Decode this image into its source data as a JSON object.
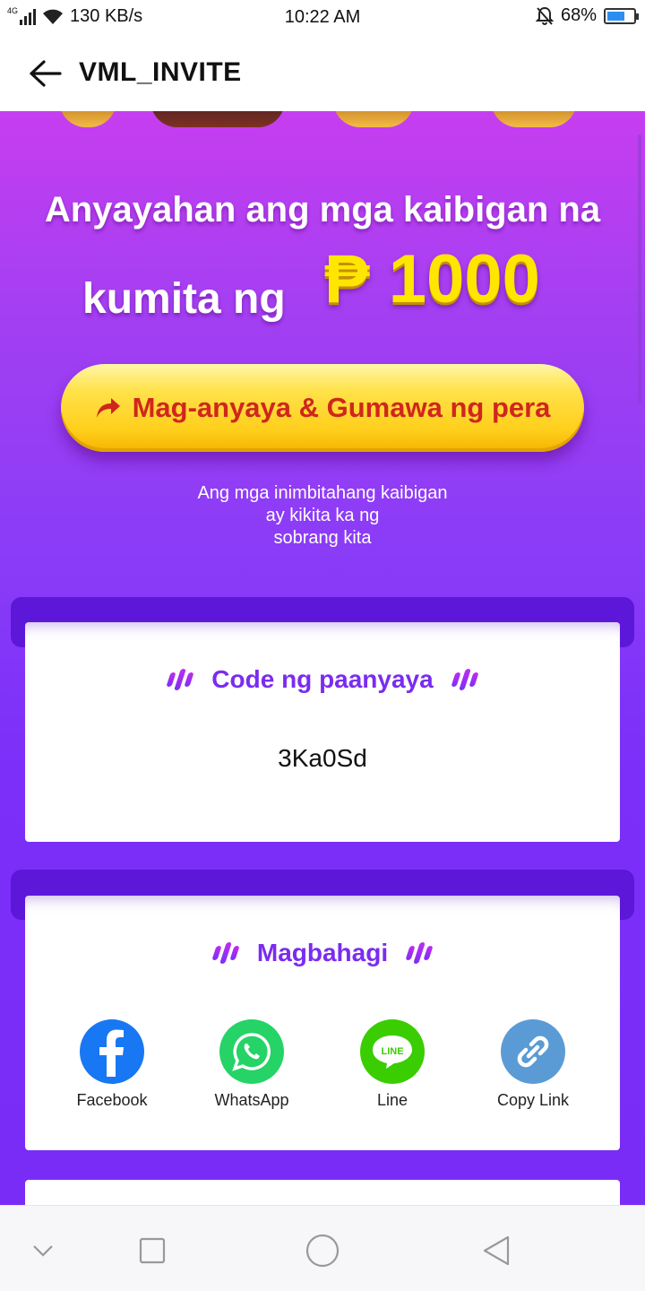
{
  "status_bar": {
    "network": "4G",
    "speed": "130 KB/s",
    "time": "10:22 AM",
    "battery": "68%",
    "battery_level": 0.68,
    "icons": [
      "signal-icon",
      "wifi-icon",
      "mute-bell-icon",
      "battery-icon"
    ]
  },
  "header": {
    "title": "VML_INVITE",
    "back_icon": "arrow-left-icon"
  },
  "hero": {
    "line1": "Anyayahan ang mga kaibigan na",
    "line2": "kumita ng",
    "amount": "₱ 1000"
  },
  "cta": {
    "label": "Mag-anyaya & Gumawa ng pera",
    "icon": "share-arrow-icon"
  },
  "subtext": {
    "line1": "Ang mga inimbitahang kaibigan",
    "line2": "ay kikita ka ng",
    "line3": "sobrang kita"
  },
  "invite_card": {
    "title": "Code ng paanyaya",
    "code": "3Ka0Sd"
  },
  "share_card": {
    "title": "Magbahagi",
    "items": [
      {
        "label": "Facebook",
        "icon": "facebook-icon",
        "color": "#1877f2"
      },
      {
        "label": "WhatsApp",
        "icon": "whatsapp-icon",
        "color": "#25d366"
      },
      {
        "label": "Line",
        "icon": "line-icon",
        "color": "#3acd01"
      },
      {
        "label": "Copy Link",
        "icon": "link-icon",
        "color": "#5b9bd5"
      }
    ]
  },
  "colors": {
    "accent_purple": "#7a2cf0",
    "cta_text": "#d0261d",
    "amount_yellow": "#ffe600"
  },
  "navbar": {
    "icons": [
      "chevron-down-icon",
      "square-icon",
      "circle-home-icon",
      "triangle-back-icon"
    ]
  }
}
